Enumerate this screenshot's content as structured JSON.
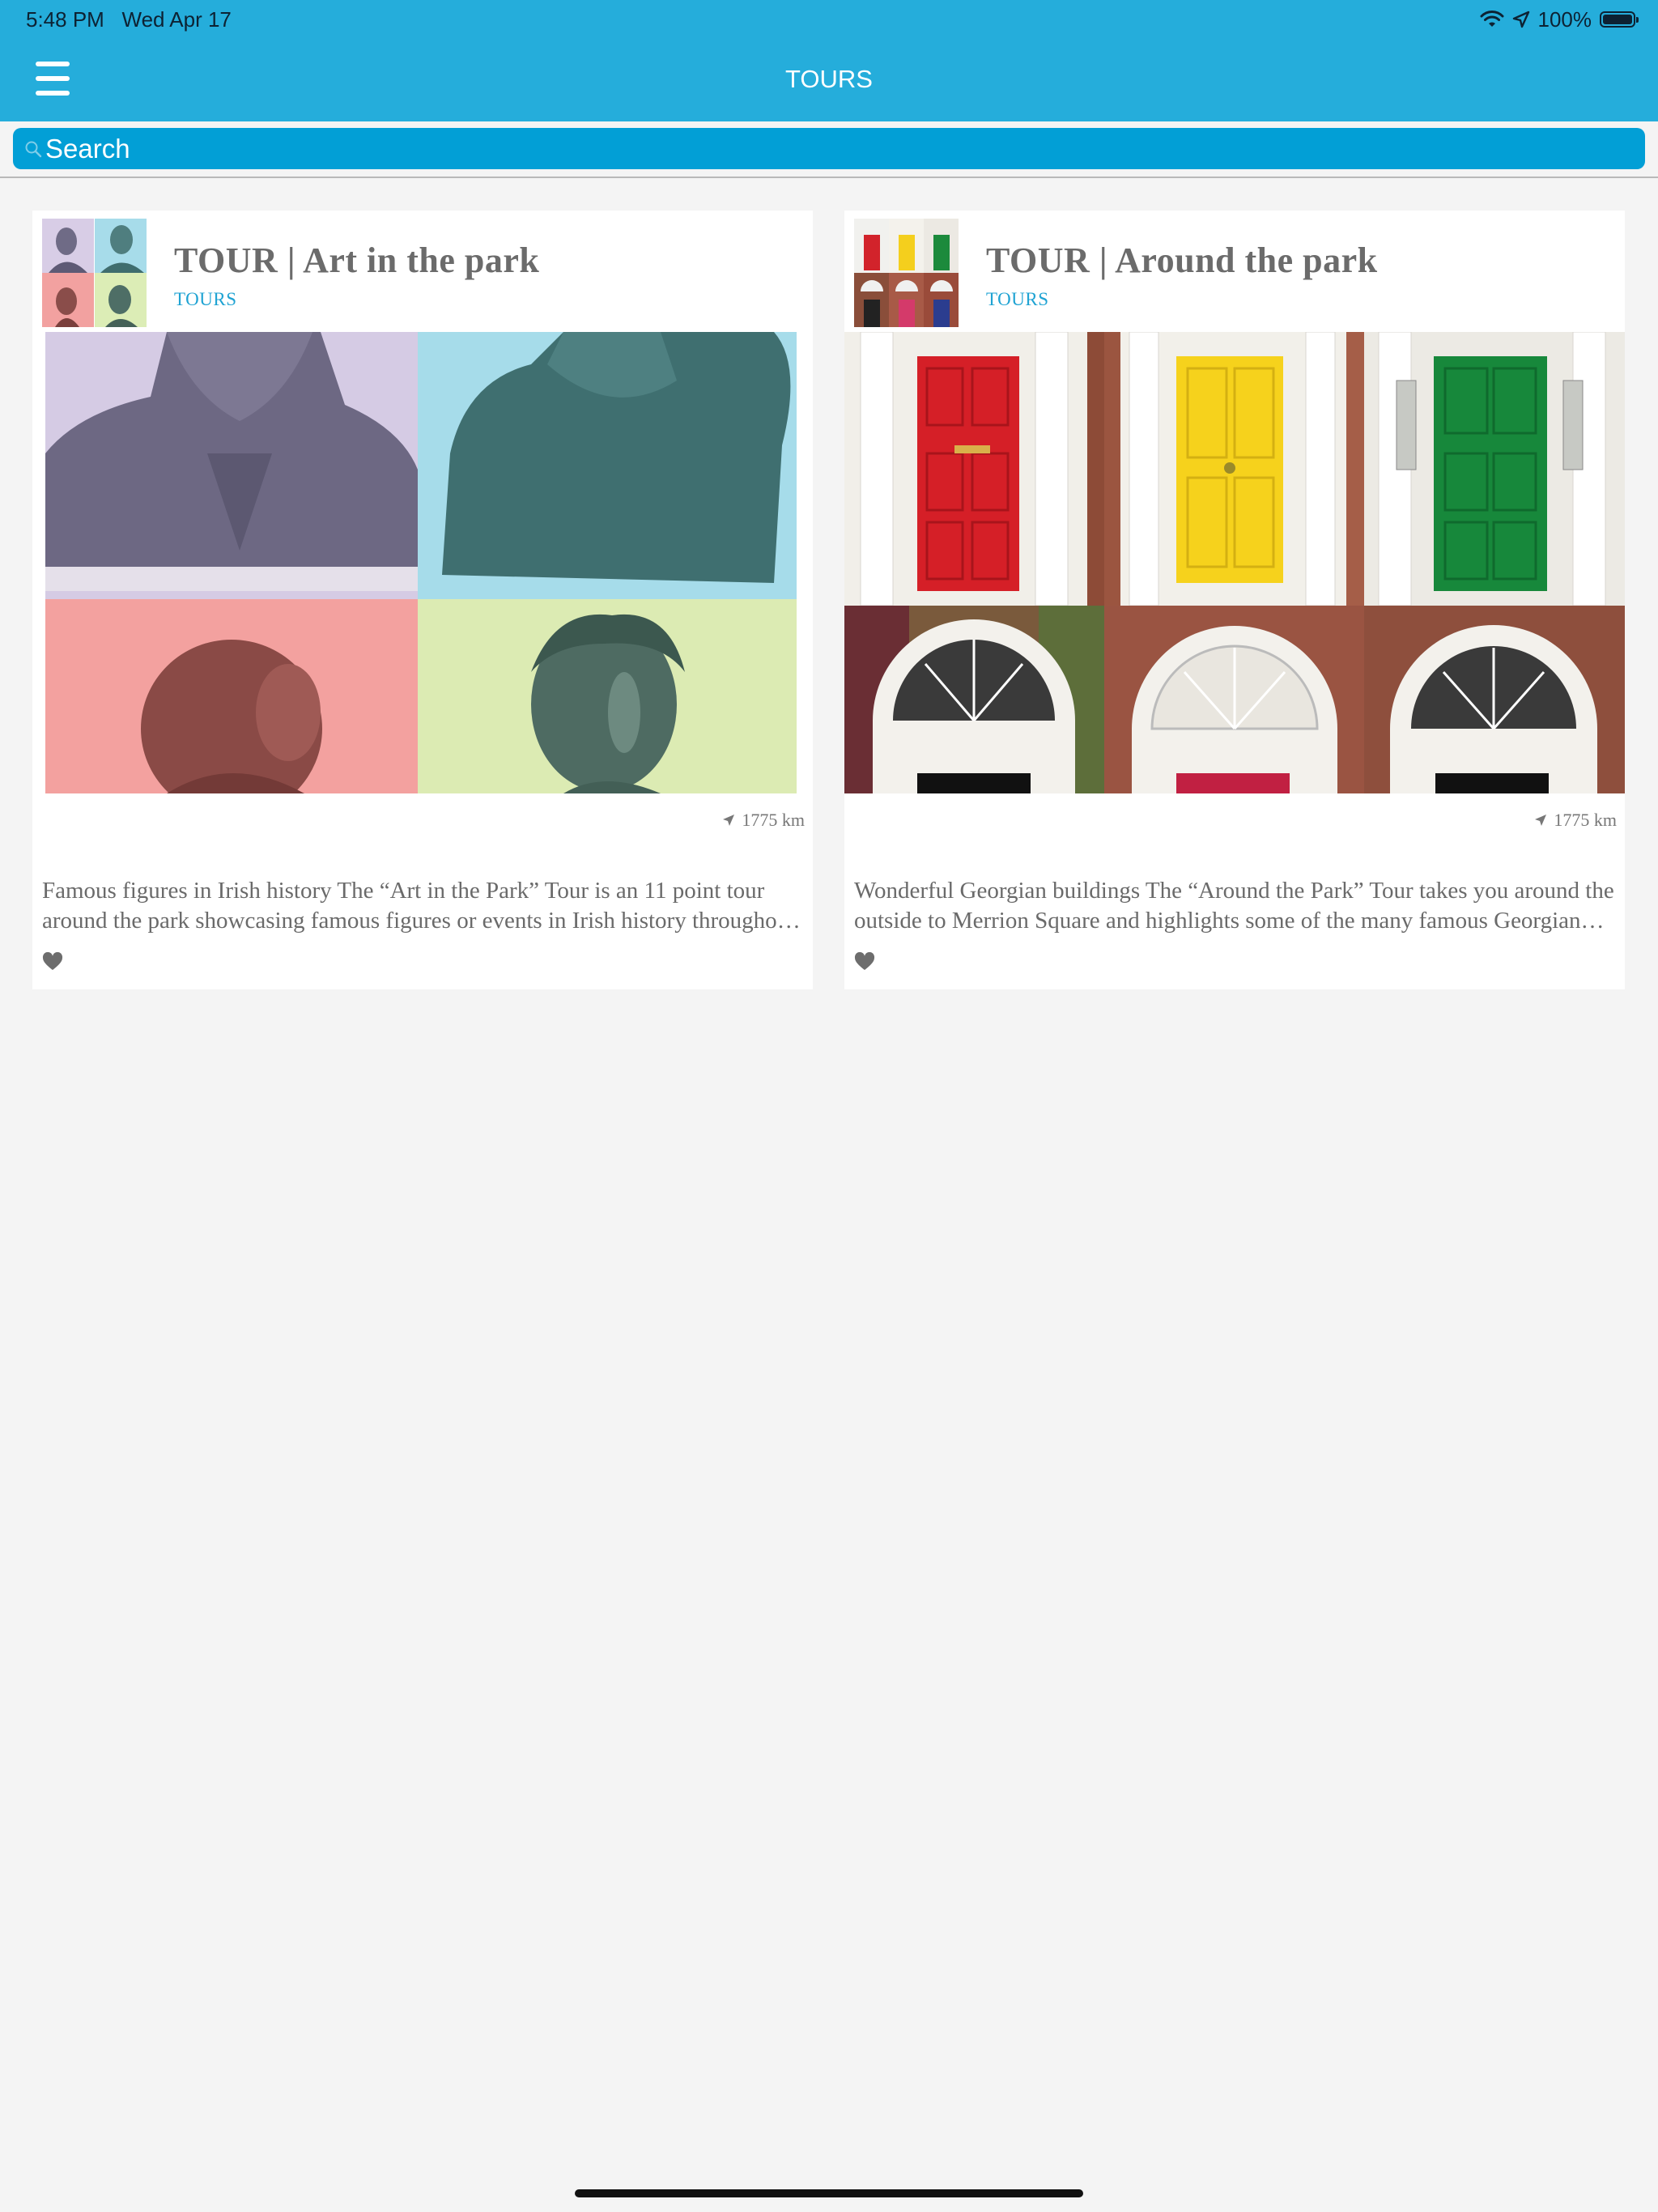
{
  "status_bar": {
    "time": "5:48 PM",
    "date": "Wed Apr 17",
    "battery": "100%",
    "battery_level": 1.0
  },
  "nav": {
    "title": "TOURS"
  },
  "search": {
    "placeholder": "Search"
  },
  "colors": {
    "nav_bg": "#25addb",
    "search_bg": "#029fd6",
    "category": "#1fa3d3",
    "page_bg": "#f4f4f4"
  },
  "icons": [
    "menu-icon",
    "search-icon",
    "wifi-icon",
    "location-icon",
    "battery-icon",
    "navigation-arrow-icon",
    "heart-icon"
  ],
  "tours": [
    {
      "title": "TOUR | Art in the park",
      "category": "TOURS",
      "distance": "1775 km",
      "description": "Famous figures in Irish history The “Art in the Park” Tour is an 11 point tour around the park showcasing famous figures or events in Irish history throughout the park."
    },
    {
      "title": "TOUR | Around the park",
      "category": "TOURS",
      "distance": "1775 km",
      "description": "Wonderful Georgian buildings The “Around the Park” Tour takes you around the outside to Merrion Square and highlights some of the many famous Georgian buildings."
    }
  ]
}
